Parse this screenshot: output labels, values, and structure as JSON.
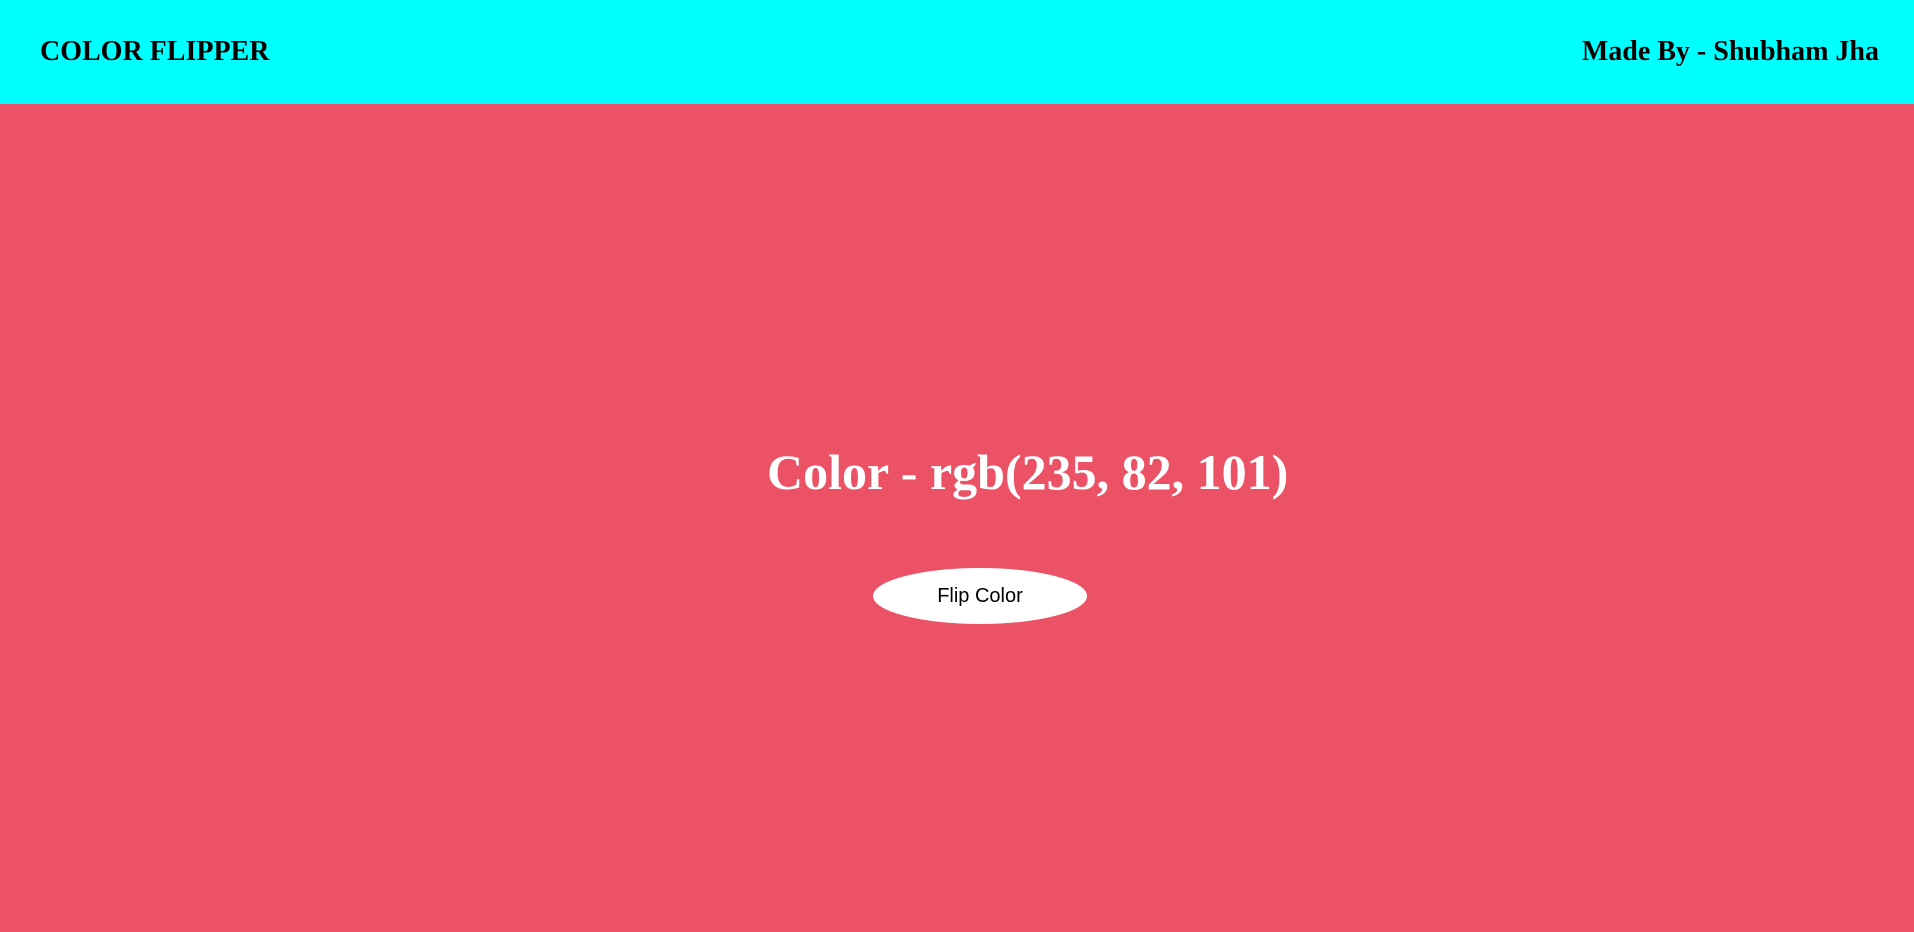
{
  "header": {
    "brand": "COLOR FLIPPER",
    "credit": "Made By - Shubham Jha",
    "background_color": "#00ffff"
  },
  "main": {
    "color_label": "Color - ",
    "color_value": "rgb(235, 82, 101)",
    "background_color": "#eb5265",
    "flip_button_label": "Flip Color"
  }
}
